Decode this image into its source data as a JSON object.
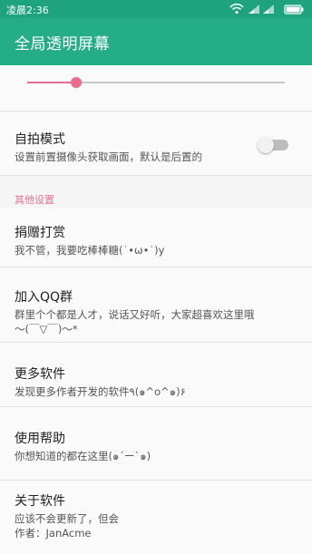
{
  "status_bar": {
    "time": "凌晨2:36"
  },
  "app_bar": {
    "title": "全局透明屏幕"
  },
  "transparency_slider": {
    "value_fraction": 0.19
  },
  "settings": {
    "selfie_mode": {
      "title": "自拍模式",
      "subtitle": "设置前置摄像头获取画面，默认是后置的",
      "enabled": false
    },
    "section_other": "其他设置",
    "donate": {
      "title": "捐赠打赏",
      "subtitle": "我不管，我要吃棒棒糖(˙•ω•˙)y"
    },
    "join_qq": {
      "title": "加入QQ群",
      "subtitle_line1": "群里个个都是人才，说话又好听，大家超喜欢这里哦",
      "subtitle_line2": "～(￣▽￣)～*"
    },
    "more_apps": {
      "title": "更多软件",
      "subtitle": "发现更多作者开发的软件٩(๑^o^๑)۶"
    },
    "help": {
      "title": "使用帮助",
      "subtitle": "你想知道的都在这里(๑´ー`๑)"
    },
    "about": {
      "title": "关于软件",
      "subtitle_line1": "应该不会更新了，但会",
      "subtitle_line2": "作者：JanAcme"
    }
  },
  "colors": {
    "primary": "#25ad88",
    "status_bar": "#1fa37f",
    "accent": "#e96a8f"
  },
  "icons": [
    "wifi-icon",
    "signal-icon",
    "signal-icon-2",
    "battery-icon"
  ]
}
